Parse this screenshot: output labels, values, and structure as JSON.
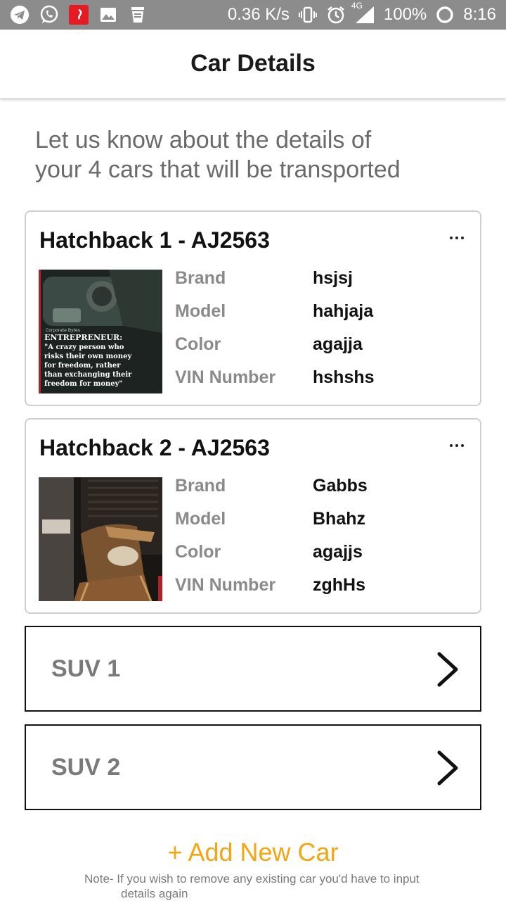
{
  "status_bar": {
    "network_speed": "0.36 K/s",
    "network_type": "4G",
    "battery": "100%",
    "time": "8:16",
    "left_icons": [
      "telegram-icon",
      "whatsapp-icon",
      "airtel-icon",
      "gallery-icon",
      "cleaner-icon"
    ],
    "right_icons": [
      "vibrate-icon",
      "alarm-icon",
      "signal-icon",
      "battery-icon"
    ]
  },
  "header": {
    "title": "Car Details"
  },
  "intro": {
    "line1": "Let us know about the details of",
    "line2": "your 4 cars that will be transported"
  },
  "cars": [
    {
      "title": "Hatchback 1 - AJ2563",
      "specs": [
        {
          "label": "Brand",
          "value": "hsjsj"
        },
        {
          "label": "Model",
          "value": "hahjaja"
        },
        {
          "label": "Color",
          "value": "agajja"
        },
        {
          "label": "VIN Number",
          "value": "hshshs"
        }
      ],
      "image": {
        "caption_title": "ENTREPRENEUR:",
        "caption_lines": [
          "\"A crazy person who",
          "risks their own money",
          "for freedom, rather",
          "than exchanging their",
          "freedom for money\""
        ]
      }
    },
    {
      "title": "Hatchback 2 - AJ2563",
      "specs": [
        {
          "label": "Brand",
          "value": "Gabbs"
        },
        {
          "label": "Model",
          "value": "Bhahz"
        },
        {
          "label": "Color",
          "value": "agajjs"
        },
        {
          "label": "VIN Number",
          "value": "zghHs"
        }
      ]
    }
  ],
  "collapsed_cars": [
    {
      "label": "SUV 1"
    },
    {
      "label": "SUV 2"
    }
  ],
  "add_car_label": "+ Add New Car",
  "note": {
    "line1": "Note- If you wish to remove any existing car you'd have to input",
    "line2": "details again"
  },
  "colors": {
    "accent": "#f2a712",
    "status_bar": "#8c8c8c",
    "label_gray": "#8a8a8a"
  }
}
